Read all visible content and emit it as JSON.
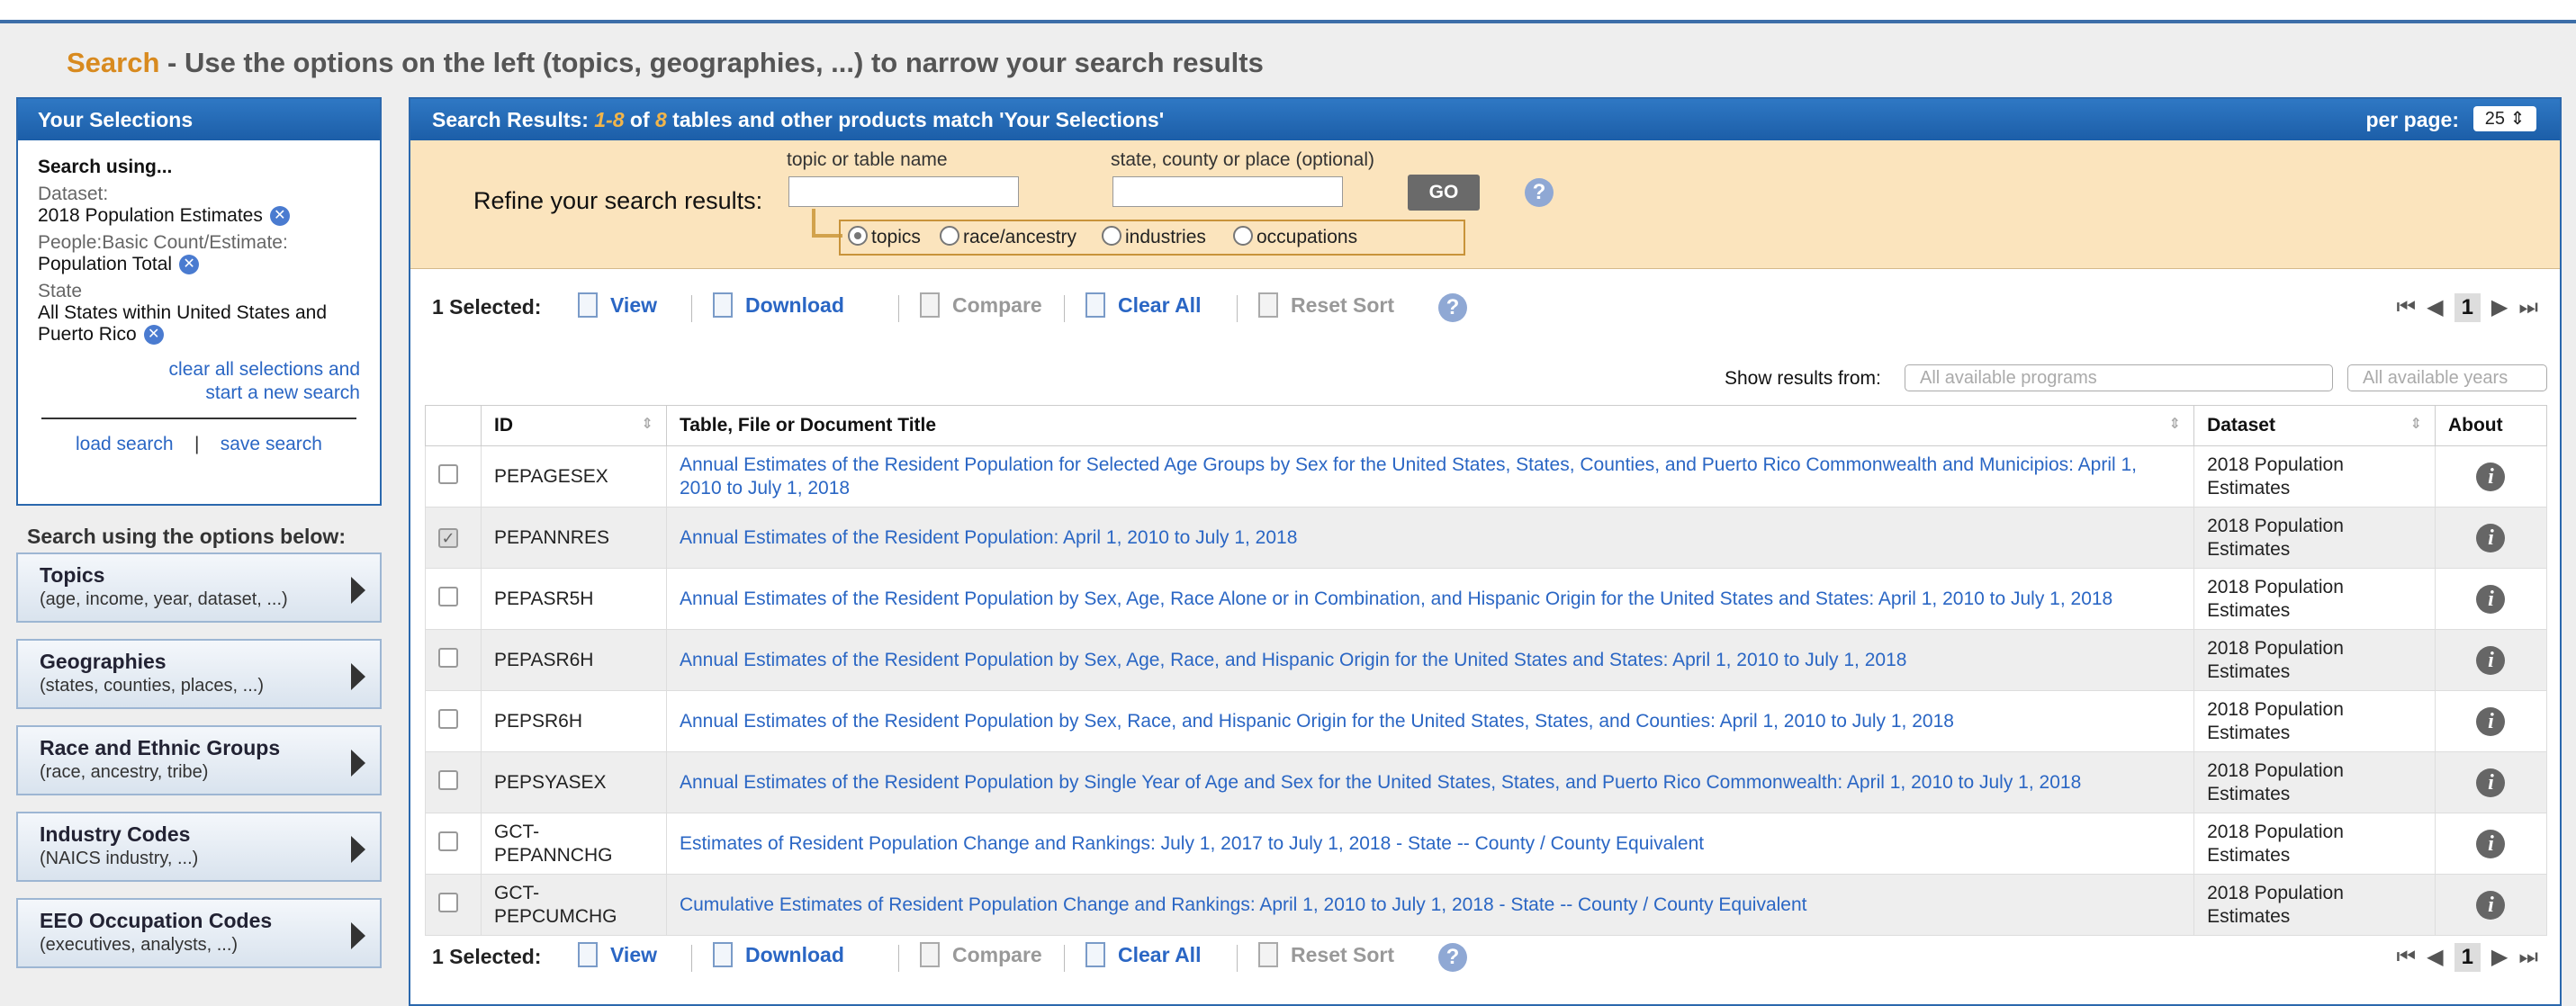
{
  "heading": {
    "accent": "Search",
    "rest": " - Use the options on the left (topics, geographies, ...) to narrow your search results"
  },
  "selections": {
    "header": "Your Selections",
    "search_using": "Search using...",
    "items": [
      {
        "label": "Dataset:",
        "value": "2018 Population Estimates"
      },
      {
        "label": "People:Basic Count/Estimate:",
        "value": "Population Total"
      },
      {
        "label": "State",
        "value": "All States within United States and Puerto Rico"
      }
    ],
    "clear_line1": "clear all selections and",
    "clear_line2": "start a new search",
    "load_search": "load search",
    "divider": "|",
    "save_search": "save search"
  },
  "options": {
    "heading": "Search using the options below:",
    "items": [
      {
        "title": "Topics",
        "subtitle": "(age, income, year, dataset, ...)"
      },
      {
        "title": "Geographies",
        "subtitle": "(states, counties, places, ...)"
      },
      {
        "title": "Race and Ethnic Groups",
        "subtitle": "(race, ancestry, tribe)"
      },
      {
        "title": "Industry Codes",
        "subtitle": "(NAICS industry, ...)"
      },
      {
        "title": "EEO Occupation Codes",
        "subtitle": "(executives, analysts, ...)"
      }
    ]
  },
  "results_header": {
    "prefix": "Search Results: ",
    "range": "1-8",
    "of": " of ",
    "total": "8",
    "suffix": " tables and other products match 'Your Selections'",
    "per_page_label": "per page:",
    "per_page_value": "25 ⇕"
  },
  "refine": {
    "label": "Refine your search results:",
    "topic_label": "topic or table name",
    "geo_label": "state, county or place (optional)",
    "go": "GO",
    "help": "?",
    "radios": [
      "topics",
      "race/ancestry",
      "industries",
      "occupations"
    ]
  },
  "toolbar": {
    "selected": "1 Selected:",
    "view": "View",
    "download": "Download",
    "compare": "Compare",
    "clear_all": "Clear All",
    "reset_sort": "Reset Sort",
    "help": "?",
    "page": "1"
  },
  "filters": {
    "label": "Show results from:",
    "programs": "All available programs",
    "years": "All available years"
  },
  "table": {
    "columns": [
      "ID",
      "Table, File or Document Title",
      "Dataset",
      "About"
    ],
    "rows": [
      {
        "id": "PEPAGESEX",
        "title": "Annual Estimates of the Resident Population for Selected Age Groups by Sex for the United States, States, Counties, and Puerto Rico Commonwealth and Municipios: April 1, 2010 to July 1, 2018",
        "dataset": "2018 Population Estimates",
        "checked": false
      },
      {
        "id": "PEPANNRES",
        "title": "Annual Estimates of the Resident Population: April 1, 2010 to July 1, 2018",
        "dataset": "2018 Population Estimates",
        "checked": true
      },
      {
        "id": "PEPASR5H",
        "title": "Annual Estimates of the Resident Population by Sex, Age, Race Alone or in Combination, and Hispanic Origin for the United States and States: April 1, 2010 to July 1, 2018",
        "dataset": "2018 Population Estimates",
        "checked": false
      },
      {
        "id": "PEPASR6H",
        "title": "Annual Estimates of the Resident Population by Sex, Age, Race, and Hispanic Origin for the United States and States: April 1, 2010 to July 1, 2018",
        "dataset": "2018 Population Estimates",
        "checked": false
      },
      {
        "id": "PEPSR6H",
        "title": "Annual Estimates of the Resident Population by Sex, Race, and Hispanic Origin for the United States, States, and Counties: April 1, 2010 to July 1, 2018",
        "dataset": "2018 Population Estimates",
        "checked": false
      },
      {
        "id": "PEPSYASEX",
        "title": "Annual Estimates of the Resident Population by Single Year of Age and Sex for the United States, States, and Puerto Rico Commonwealth: April 1, 2010 to July 1, 2018",
        "dataset": "2018 Population Estimates",
        "checked": false
      },
      {
        "id": "GCT-PEPANNCHG",
        "title": "Estimates of Resident Population Change and Rankings: July 1, 2017 to July 1, 2018 - State -- County / County Equivalent",
        "dataset": "2018 Population Estimates",
        "checked": false
      },
      {
        "id": "GCT-PEPCUMCHG",
        "title": "Cumulative Estimates of Resident Population Change and Rankings: April 1, 2010 to July 1, 2018 - State -- County / County Equivalent",
        "dataset": "2018 Population Estimates",
        "checked": false
      }
    ]
  },
  "colors": {
    "accent": "#d88a1f",
    "header_blue": "#1c5ea8",
    "link": "#2a66c4",
    "refine_bg": "#fbe4bd"
  }
}
